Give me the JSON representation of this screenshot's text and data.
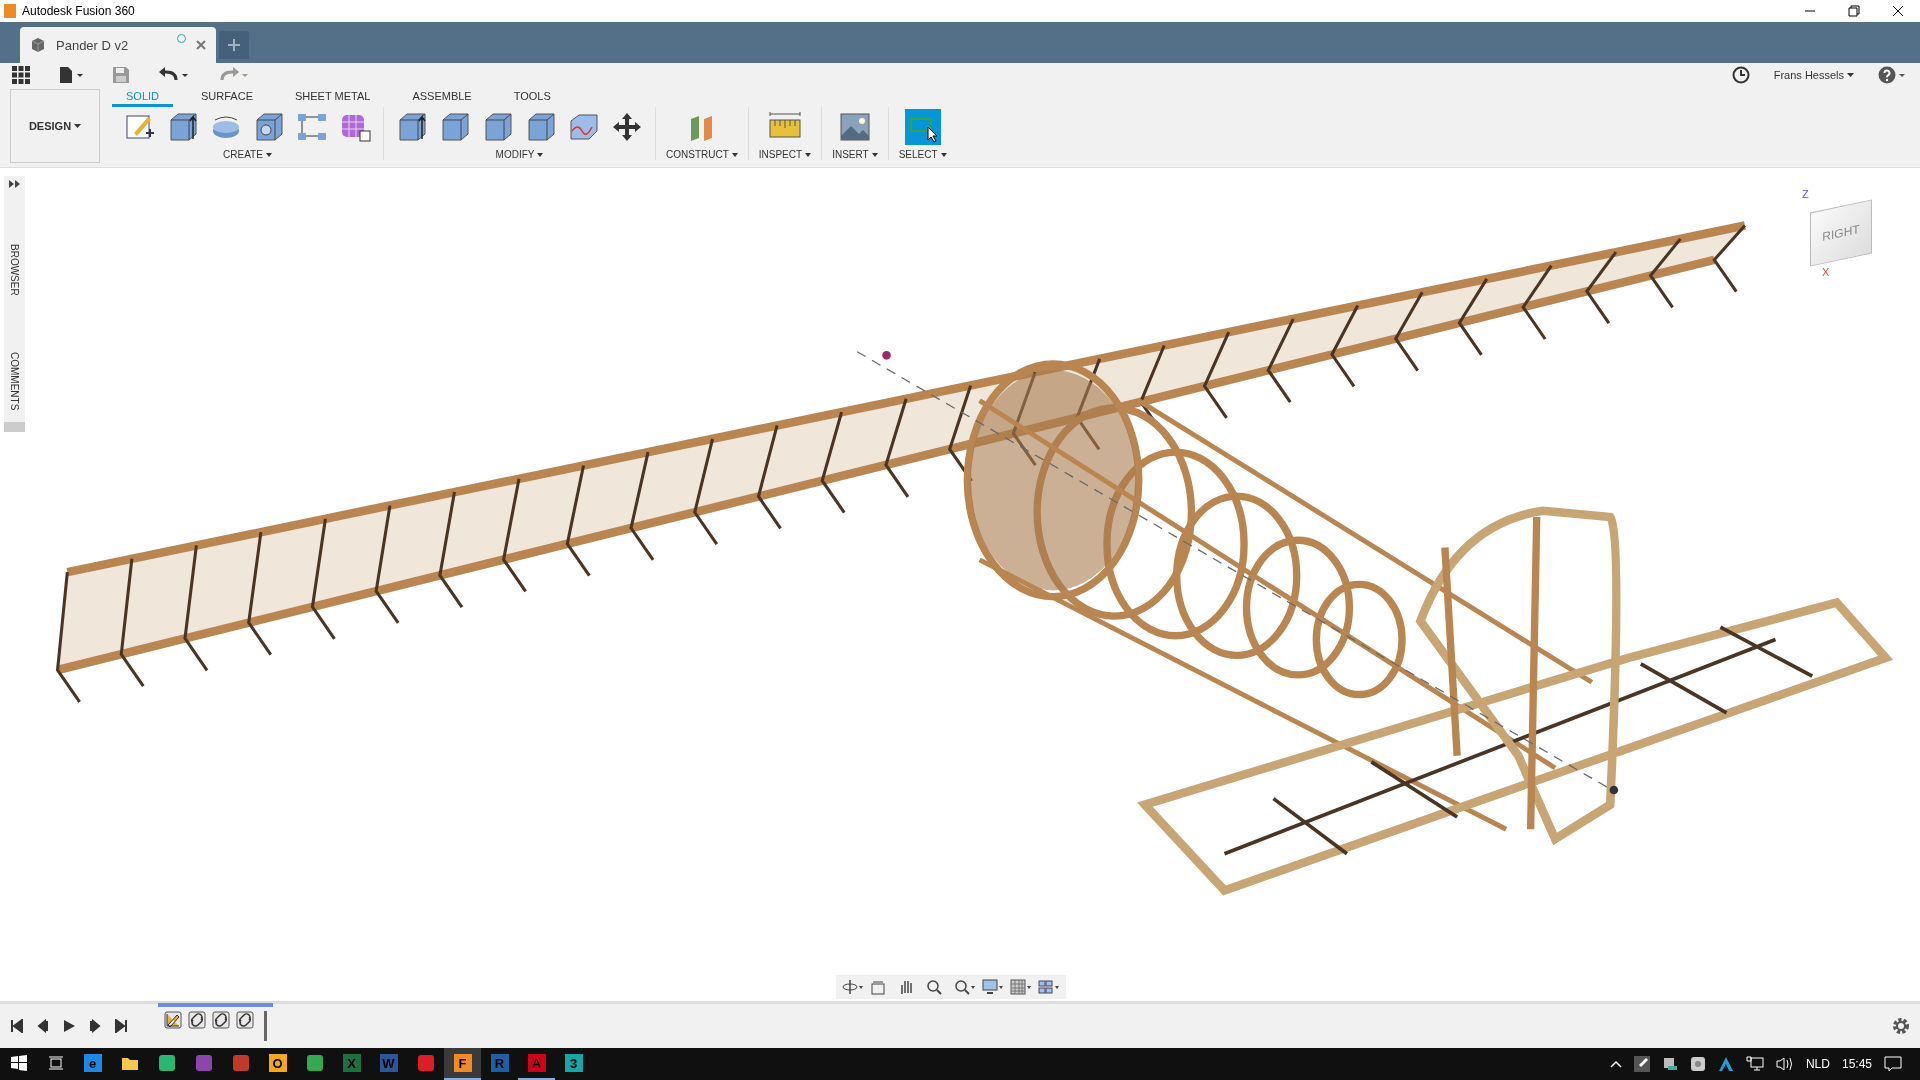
{
  "window": {
    "title": "Autodesk Fusion 360"
  },
  "document_tabs": [
    {
      "label": "Pander D v2",
      "selected": true
    }
  ],
  "user": {
    "name": "Frans Hessels"
  },
  "workspace": {
    "label": "DESIGN"
  },
  "toolbar_tabs": [
    {
      "label": "SOLID",
      "selected": true
    },
    {
      "label": "SURFACE",
      "selected": false
    },
    {
      "label": "SHEET METAL",
      "selected": false
    },
    {
      "label": "ASSEMBLE",
      "selected": false
    },
    {
      "label": "TOOLS",
      "selected": false
    }
  ],
  "tool_groups": [
    {
      "label": "CREATE",
      "tools": [
        {
          "kind": "sketch",
          "active": false
        },
        {
          "kind": "extrude",
          "active": false
        },
        {
          "kind": "revolve",
          "active": false
        },
        {
          "kind": "hole",
          "active": false
        },
        {
          "kind": "pattern",
          "active": false
        },
        {
          "kind": "form",
          "active": false
        }
      ]
    },
    {
      "label": "MODIFY",
      "tools": [
        {
          "kind": "presspull",
          "active": false
        },
        {
          "kind": "fillet",
          "active": false
        },
        {
          "kind": "shell",
          "active": false
        },
        {
          "kind": "combine",
          "active": false
        },
        {
          "kind": "face",
          "active": false
        },
        {
          "kind": "move",
          "active": false
        }
      ]
    },
    {
      "label": "CONSTRUCT",
      "tools": [
        {
          "kind": "plane",
          "active": false
        }
      ]
    },
    {
      "label": "INSPECT",
      "tools": [
        {
          "kind": "measure",
          "active": false
        }
      ]
    },
    {
      "label": "INSERT",
      "tools": [
        {
          "kind": "image",
          "active": false
        }
      ]
    },
    {
      "label": "SELECT",
      "tools": [
        {
          "kind": "select",
          "active": true
        }
      ]
    }
  ],
  "side_panel": [
    {
      "label": "BROWSER"
    },
    {
      "label": "COMMENTS"
    }
  ],
  "view_cube": {
    "face": "RIGHT",
    "axes": [
      "Z",
      "X"
    ]
  },
  "nav_bar": [
    {
      "kind": "orbit"
    },
    {
      "kind": "look"
    },
    {
      "kind": "pan"
    },
    {
      "kind": "zoom"
    },
    {
      "kind": "fit"
    },
    {
      "kind": "display"
    },
    {
      "kind": "grid"
    },
    {
      "kind": "viewports"
    }
  ],
  "timeline": [
    {
      "kind": "sketch"
    },
    {
      "kind": "joint"
    },
    {
      "kind": "joint"
    },
    {
      "kind": "joint"
    }
  ],
  "taskbar": {
    "apps": [
      {
        "kind": "start",
        "open": false,
        "active": false
      },
      {
        "kind": "taskview",
        "open": false,
        "active": false
      },
      {
        "kind": "app",
        "glyph": "e",
        "color": "#1e88e5",
        "open": false,
        "active": false
      },
      {
        "kind": "folder",
        "open": false,
        "active": false
      },
      {
        "kind": "app",
        "color": "#2bb673",
        "open": false,
        "active": false
      },
      {
        "kind": "app",
        "color": "#8e44ad",
        "open": false,
        "active": false
      },
      {
        "kind": "app",
        "color": "#c0392b",
        "open": false,
        "active": false
      },
      {
        "kind": "app",
        "glyph": "O",
        "color": "#f5a623",
        "open": false,
        "active": false
      },
      {
        "kind": "app",
        "color": "#34a853",
        "open": false,
        "active": false
      },
      {
        "kind": "app",
        "glyph": "X",
        "color": "#1d6f42",
        "open": false,
        "active": false
      },
      {
        "kind": "app",
        "glyph": "W",
        "color": "#2b579a",
        "open": false,
        "active": false
      },
      {
        "kind": "app",
        "color": "#da1f26",
        "open": false,
        "active": false
      },
      {
        "kind": "app",
        "glyph": "F",
        "color": "#f08a24",
        "open": true,
        "active": true
      },
      {
        "kind": "app",
        "glyph": "R",
        "color": "#1f5fa8",
        "open": false,
        "active": false
      },
      {
        "kind": "app",
        "glyph": "A",
        "color": "#d0021b",
        "open": true,
        "active": false
      },
      {
        "kind": "app",
        "glyph": "3",
        "color": "#1aa6a6",
        "open": false,
        "active": false
      }
    ],
    "tray": {
      "language": "NLD",
      "time": "15:45"
    }
  }
}
